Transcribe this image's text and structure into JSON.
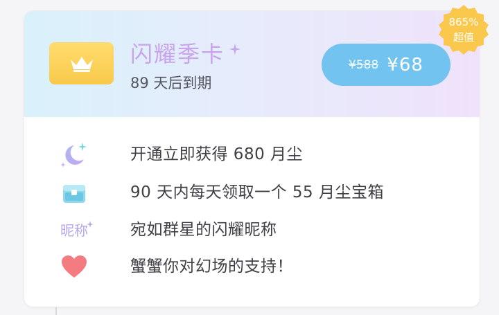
{
  "card": {
    "title": "闪耀季卡",
    "subtitle": "89 天后到期",
    "price_old": "¥588",
    "price_new": "¥68",
    "badge_percent": "865%",
    "badge_label": "超值"
  },
  "benefits": [
    {
      "icon": "moon-stars-icon",
      "text": "开通立即获得 680 月尘"
    },
    {
      "icon": "treasure-chest-icon",
      "text": "90 天内每天领取一个 55 月尘宝箱"
    },
    {
      "icon": "nickname-icon",
      "icon_text": "昵称",
      "text": "宛如群星的闪耀昵称"
    },
    {
      "icon": "heart-icon",
      "text": "蟹蟹你对幻场的支持！"
    }
  ],
  "colors": {
    "price_button": "#72c3ef",
    "title": "#c9a3ec",
    "crown_box": "#f8c94a",
    "badge": "#f9c84c",
    "heart": "#f47b80"
  }
}
